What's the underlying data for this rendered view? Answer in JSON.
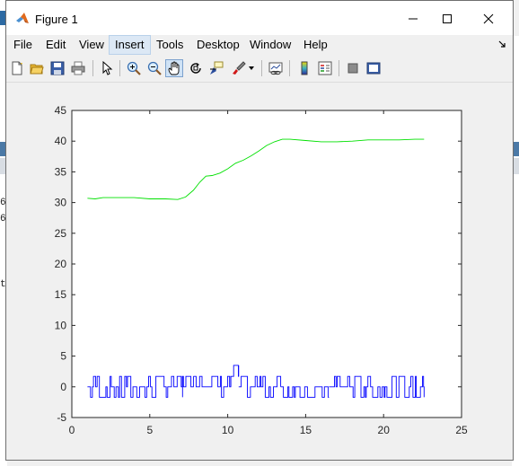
{
  "window": {
    "title": "Figure 1",
    "minimize_symbol": "—",
    "maximize_symbol": "☐",
    "close_symbol": "✕",
    "icon": "matlab-logo-icon"
  },
  "menubar": {
    "items": [
      {
        "label": "File"
      },
      {
        "label": "Edit"
      },
      {
        "label": "View"
      },
      {
        "label": "Insert"
      },
      {
        "label": "Tools"
      },
      {
        "label": "Desktop"
      },
      {
        "label": "Window"
      },
      {
        "label": "Help"
      }
    ],
    "active_item": "Insert",
    "dock_icon": "dock-arrow-icon"
  },
  "toolbar": {
    "buttons": [
      {
        "icon": "new-figure-icon"
      },
      {
        "icon": "open-file-icon"
      },
      {
        "icon": "save-icon"
      },
      {
        "icon": "print-icon"
      },
      {
        "icon": "edit-plot-arrow-icon"
      },
      {
        "icon": "zoom-in-icon"
      },
      {
        "icon": "zoom-out-icon"
      },
      {
        "icon": "pan-hand-icon"
      },
      {
        "icon": "rotate-3d-icon"
      },
      {
        "icon": "data-cursor-icon"
      },
      {
        "icon": "brush-icon"
      },
      {
        "icon": "brush-dropdown-icon"
      },
      {
        "icon": "link-plot-icon"
      },
      {
        "icon": "colorbar-icon"
      },
      {
        "icon": "legend-icon"
      },
      {
        "icon": "hide-plot-tools-icon"
      },
      {
        "icon": "show-plot-tools-icon"
      }
    ],
    "pressed_tool": "pan-hand-icon"
  },
  "background_text": {
    "line1": "6",
    "line2": "6",
    "line3": "t"
  },
  "chart_data": {
    "type": "line",
    "xlim": [
      0,
      25
    ],
    "ylim": [
      -5,
      45
    ],
    "xticks": [
      0,
      5,
      10,
      15,
      20,
      25
    ],
    "yticks": [
      -5,
      0,
      5,
      10,
      15,
      20,
      25,
      30,
      35,
      40,
      45
    ],
    "x_tick_labels": [
      "0",
      "5",
      "10",
      "15",
      "20",
      "25"
    ],
    "y_tick_labels": [
      "-5",
      "0",
      "5",
      "10",
      "15",
      "20",
      "25",
      "30",
      "35",
      "40",
      "45"
    ],
    "grid": false,
    "series": [
      {
        "color": "#00e000",
        "x": [
          1.0,
          1.5,
          2.0,
          3.0,
          4.0,
          5.0,
          6.0,
          6.8,
          7.3,
          7.8,
          8.2,
          8.6,
          9.0,
          9.5,
          10.0,
          10.5,
          11.0,
          11.5,
          12.0,
          12.5,
          13.0,
          13.5,
          14.0,
          15.0,
          16.0,
          17.0,
          18.0,
          19.0,
          20.0,
          21.0,
          22.0,
          22.6
        ],
        "y": [
          30.7,
          30.6,
          30.8,
          30.8,
          30.8,
          30.6,
          30.6,
          30.5,
          30.9,
          32.0,
          33.3,
          34.3,
          34.4,
          34.8,
          35.5,
          36.4,
          36.9,
          37.6,
          38.4,
          39.3,
          39.9,
          40.3,
          40.3,
          40.1,
          39.9,
          39.9,
          40.0,
          40.2,
          40.2,
          40.2,
          40.3,
          40.3
        ]
      },
      {
        "color": "#0000ff",
        "x_range": [
          1.0,
          22.6
        ],
        "segments": [
          {
            "x": [
              1.0,
              7.1
            ],
            "levels": [
              -1.7,
              0,
              1.7
            ]
          },
          {
            "x": [
              7.1,
              7.8
            ],
            "levels": [
              0,
              1.7
            ]
          },
          {
            "x": [
              7.8,
              8.8
            ],
            "levels": [
              0,
              1.7,
              3.5
            ]
          },
          {
            "x": [
              8.8,
              10.2
            ],
            "levels": [
              -1.7,
              0,
              1.7
            ]
          },
          {
            "x": [
              10.2,
              10.7
            ],
            "levels": [
              0,
              1.7,
              3.5
            ]
          },
          {
            "x": [
              10.7,
              13.4
            ],
            "levels": [
              -1.7,
              0,
              1.7
            ]
          },
          {
            "x": [
              13.4,
              16.5
            ],
            "levels": [
              -1.7,
              0
            ]
          },
          {
            "x": [
              16.5,
              22.6
            ],
            "levels": [
              -1.7,
              0,
              1.7
            ]
          }
        ]
      }
    ]
  }
}
